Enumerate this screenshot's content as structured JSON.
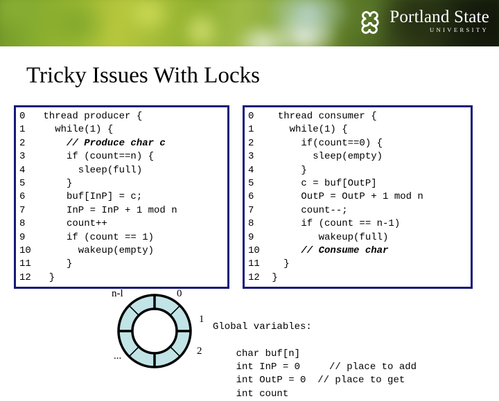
{
  "header": {
    "logo": {
      "mark_icon": "psu-knot-icon",
      "wordmark": "Portland State",
      "subwordmark": "UNIVERSITY"
    }
  },
  "slide": {
    "title": "Tricky Issues With Locks"
  },
  "producer_code": {
    "title": "producer",
    "lines": [
      {
        "n": "0",
        "src": " thread producer {"
      },
      {
        "n": "1",
        "src": "   while(1) {"
      },
      {
        "n": "2",
        "src": "     // Produce char c",
        "comment": true
      },
      {
        "n": "3",
        "src": "     if (count==n) {"
      },
      {
        "n": "4",
        "src": "       sleep(full)"
      },
      {
        "n": "5",
        "src": "     }"
      },
      {
        "n": "6",
        "src": "     buf[InP] = c;"
      },
      {
        "n": "7",
        "src": "     InP = InP + 1 mod n"
      },
      {
        "n": "8",
        "src": "     count++"
      },
      {
        "n": "9",
        "src": "     if (count == 1)"
      },
      {
        "n": "10",
        "src": "       wakeup(empty)"
      },
      {
        "n": "11",
        "src": "     }"
      },
      {
        "n": "12",
        "src": "  }"
      }
    ]
  },
  "consumer_code": {
    "title": "consumer",
    "lines": [
      {
        "n": "0",
        "src": "  thread consumer {"
      },
      {
        "n": "1",
        "src": "    while(1) {"
      },
      {
        "n": "2",
        "src": "      if(count==0) {"
      },
      {
        "n": "3",
        "src": "        sleep(empty)"
      },
      {
        "n": "4",
        "src": "      }"
      },
      {
        "n": "5",
        "src": "      c = buf[OutP]"
      },
      {
        "n": "6",
        "src": "      OutP = OutP + 1 mod n"
      },
      {
        "n": "7",
        "src": "      count--;"
      },
      {
        "n": "8",
        "src": "      if (count == n-1)"
      },
      {
        "n": "9",
        "src": "         wakeup(full)"
      },
      {
        "n": "10",
        "src": "      // Consume char",
        "comment": true
      },
      {
        "n": "11",
        "src": "   }"
      },
      {
        "n": "12",
        "src": " }"
      }
    ]
  },
  "ring": {
    "labels": {
      "n_minus_1": "n-l",
      "zero": "0",
      "one": "1",
      "two": "2",
      "ellipsis": "..."
    },
    "segments": 8,
    "fill_color": "#c2e4e6",
    "stroke_color": "#000000"
  },
  "globals": {
    "heading": "Global variables:",
    "lines": [
      "    char buf[n]",
      "    int InP = 0     // place to add",
      "    int OutP = 0  // place to get",
      "    int count"
    ]
  },
  "colors": {
    "code_border": "#181878",
    "ring_fill": "#c2e4e6",
    "text": "#000000",
    "background": "#ffffff"
  }
}
